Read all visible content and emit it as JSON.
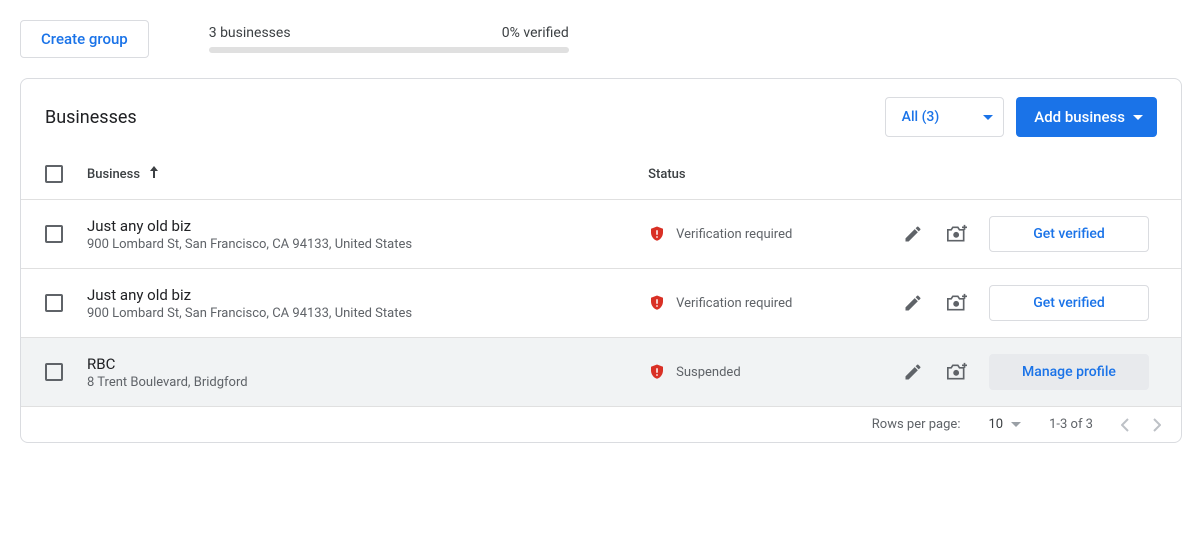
{
  "topbar": {
    "create_group_label": "Create group",
    "business_count_text": "3 businesses",
    "verified_text": "0% verified"
  },
  "card": {
    "title": "Businesses",
    "filter_label": "All (3)",
    "add_business_label": "Add business"
  },
  "table": {
    "headers": {
      "business": "Business",
      "status": "Status"
    },
    "rows": [
      {
        "name": "Just any old biz",
        "address": "900 Lombard St, San Francisco, CA 94133, United States",
        "status_text": "Verification required",
        "action_label": "Get verified",
        "action_style": "primary",
        "hover": false
      },
      {
        "name": "Just any old biz",
        "address": "900 Lombard St, San Francisco, CA 94133, United States",
        "status_text": "Verification required",
        "action_label": "Get verified",
        "action_style": "primary",
        "hover": false
      },
      {
        "name": "RBC",
        "address": "8 Trent Boulevard, Bridgford",
        "status_text": "Suspended",
        "action_label": "Manage profile",
        "action_style": "secondary",
        "hover": true
      }
    ]
  },
  "footer": {
    "rows_per_page_label": "Rows per page:",
    "rows_per_page_value": "10",
    "range_text": "1-3 of 3"
  }
}
